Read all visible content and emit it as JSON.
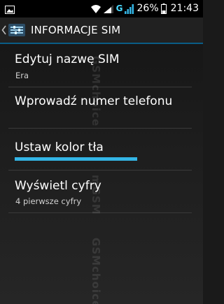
{
  "status_bar": {
    "network_type": "G",
    "battery_percent": "26%",
    "time": "21:43",
    "icons": [
      "photo-icon",
      "signal-strength-icon",
      "wifi-icon",
      "battery-icon"
    ]
  },
  "action_bar": {
    "title": "INFORMACJE SIM",
    "icons": [
      "chevron-left-icon",
      "settings-app-icon"
    ]
  },
  "list": {
    "items": [
      {
        "title": "Edytuj nazwę SIM",
        "subtitle": "Era"
      },
      {
        "title": "Wprowadź numer telefonu",
        "subtitle": ""
      },
      {
        "title": "Ustaw kolor tła",
        "subtitle": ""
      },
      {
        "title": "Wyświetl cyfry",
        "subtitle": "4 pierwsze cyfry"
      }
    ]
  },
  "watermark": {
    "text_top": "GSMchoice",
    "text_mid": "mGSM",
    "text_bottom": "GSMchoice"
  },
  "colors": {
    "accent": "#33b5e5",
    "action_bar_border": "#0a5d86",
    "background": "#1a1a1a"
  }
}
